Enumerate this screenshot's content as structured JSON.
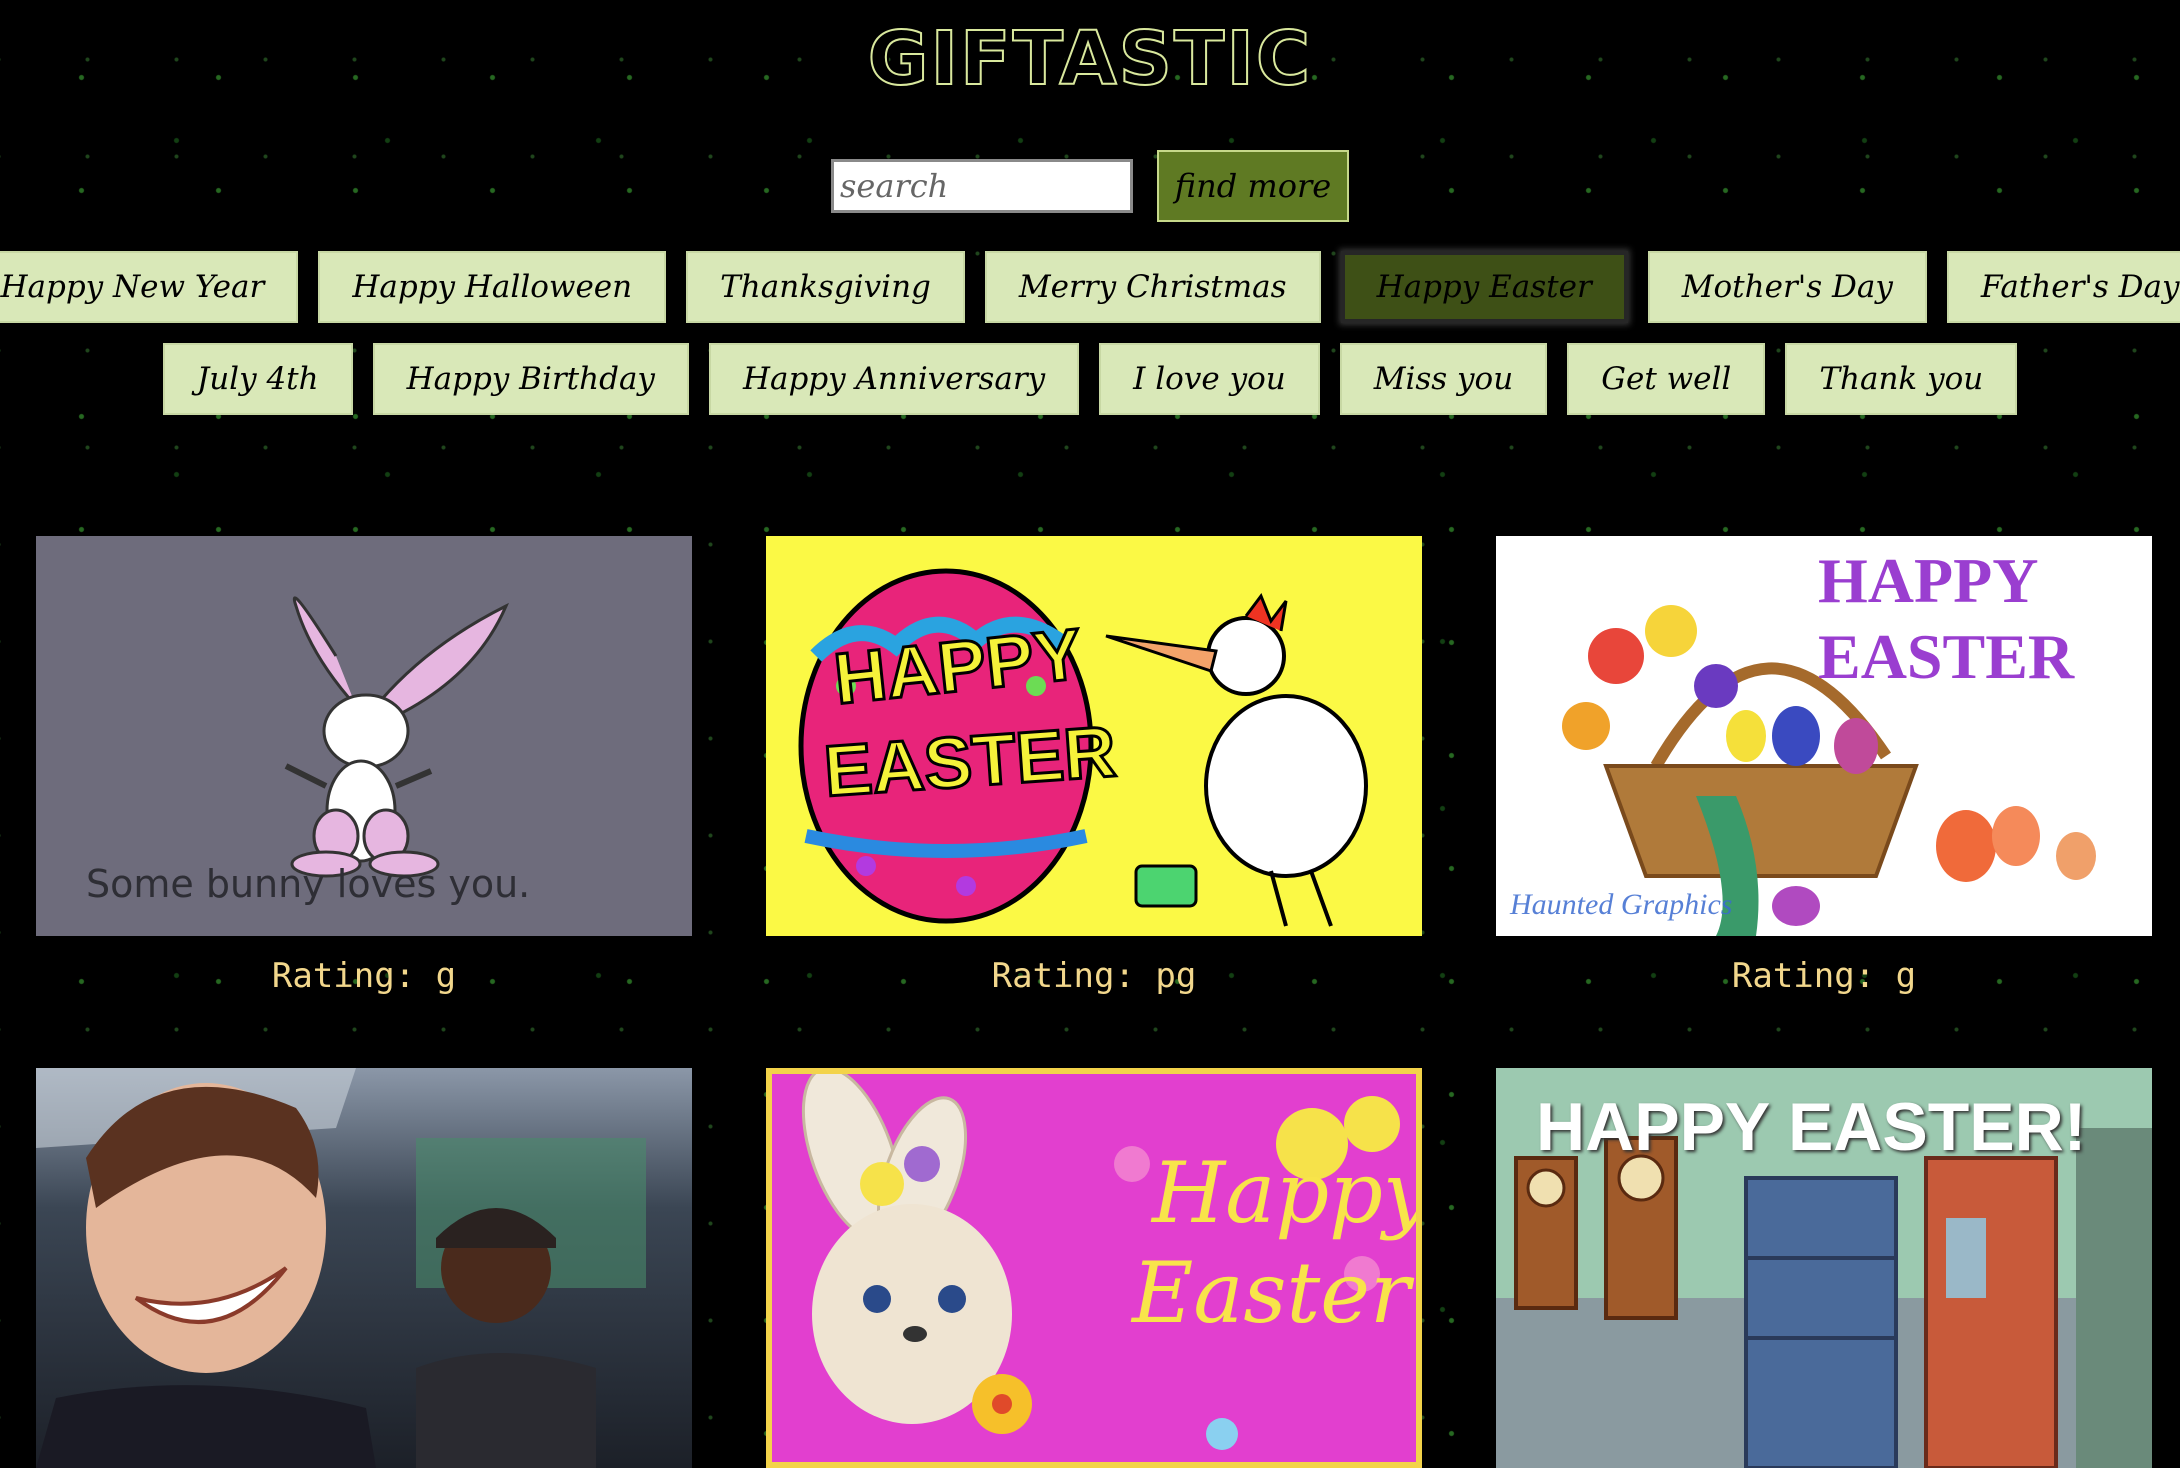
{
  "app": {
    "title": "GIFTASTIC"
  },
  "search": {
    "placeholder": "search",
    "button_label": "find more"
  },
  "categories_row1": [
    {
      "label": "Happy New Year"
    },
    {
      "label": "Happy Halloween"
    },
    {
      "label": "Thanksgiving"
    },
    {
      "label": "Merry Christmas"
    },
    {
      "label": "Happy Easter",
      "active": true
    },
    {
      "label": "Mother's Day"
    },
    {
      "label": "Father's Day"
    }
  ],
  "categories_row2": [
    {
      "label": "July 4th"
    },
    {
      "label": "Happy Birthday"
    },
    {
      "label": "Happy Anniversary"
    },
    {
      "label": "I love you"
    },
    {
      "label": "Miss you"
    },
    {
      "label": "Get well"
    },
    {
      "label": "Thank you"
    }
  ],
  "gifs": [
    {
      "rating": "Rating: g",
      "caption": "Some bunny loves you."
    },
    {
      "rating": "Rating: pg",
      "line1": "HAPPY",
      "line2": "EASTER"
    },
    {
      "rating": "Rating: g",
      "line1": "HAPPY",
      "line2": "EASTER",
      "signature": "Haunted Graphics"
    },
    {},
    {
      "line1": "Happy",
      "line2": "Easter"
    },
    {
      "banner": "HAPPY EASTER!"
    }
  ],
  "colors": {
    "background": "#000000",
    "button": "#d9e8b8",
    "button_active": "#3e5016",
    "find_button": "#5f7a23",
    "rating_text": "#f2d78c"
  }
}
